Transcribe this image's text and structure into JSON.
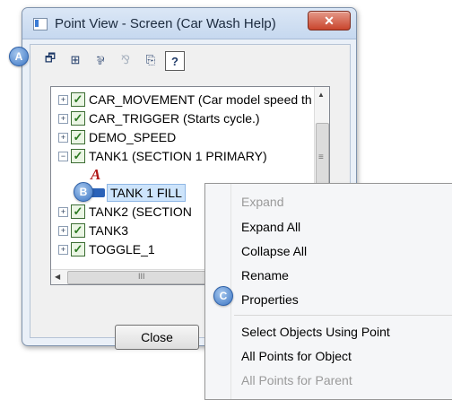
{
  "window": {
    "title": "Point View - Screen (Car Wash Help)",
    "close_glyph": "✕"
  },
  "toolbar": {
    "buttons": [
      {
        "icon": "properties-icon",
        "glyph": "🗗"
      },
      {
        "icon": "tree-structure-icon",
        "glyph": "⊞"
      },
      {
        "icon": "points-icon",
        "glyph": "⅌"
      },
      {
        "icon": "disabled-tree-icon",
        "glyph": "⅋"
      },
      {
        "icon": "copy-icon",
        "glyph": "⎘"
      },
      {
        "icon": "help-icon",
        "glyph": "?"
      }
    ]
  },
  "tree": {
    "items": [
      {
        "label": "CAR_MOVEMENT (Car model speed th",
        "expander": "+",
        "checked": true
      },
      {
        "label": "CAR_TRIGGER (Starts cycle.)",
        "expander": "+",
        "checked": true
      },
      {
        "label": "DEMO_SPEED",
        "expander": "+",
        "checked": true
      },
      {
        "label": "TANK1 (SECTION 1 PRIMARY)",
        "expander": "−",
        "checked": true
      },
      {
        "label": "A",
        "child": true,
        "kind": "text-object"
      },
      {
        "label": "TANK 1 FILL",
        "child": true,
        "kind": "fill-object",
        "selected": true
      },
      {
        "label": "TANK2 (SECTION",
        "expander": "+",
        "checked": true
      },
      {
        "label": "TANK3",
        "expander": "+",
        "checked": true
      },
      {
        "label": "TOGGLE_1",
        "expander": "+",
        "checked": true
      }
    ],
    "scroll_up": "▲",
    "scroll_grip": "≡",
    "scroll_left": "◀",
    "hscroll_grip": "III"
  },
  "buttons": {
    "close_label": "Close"
  },
  "context_menu": {
    "items": [
      {
        "label": "Expand",
        "disabled": true
      },
      {
        "label": "Expand All",
        "disabled": false
      },
      {
        "label": "Collapse All",
        "disabled": false
      },
      {
        "label": "Rename",
        "disabled": false
      },
      {
        "label": "Properties",
        "disabled": false
      },
      {
        "label": "Select Objects Using Point",
        "disabled": false
      },
      {
        "label": "All Points for Object",
        "disabled": false
      },
      {
        "label": "All Points for Parent",
        "disabled": true
      }
    ]
  },
  "callouts": {
    "a": "A",
    "b": "B",
    "c": "C"
  },
  "colors": {
    "accent": "#3b75c4",
    "selection": "#cde4fb",
    "check_green": "#2c7a22",
    "close_red": "#c9452d"
  }
}
